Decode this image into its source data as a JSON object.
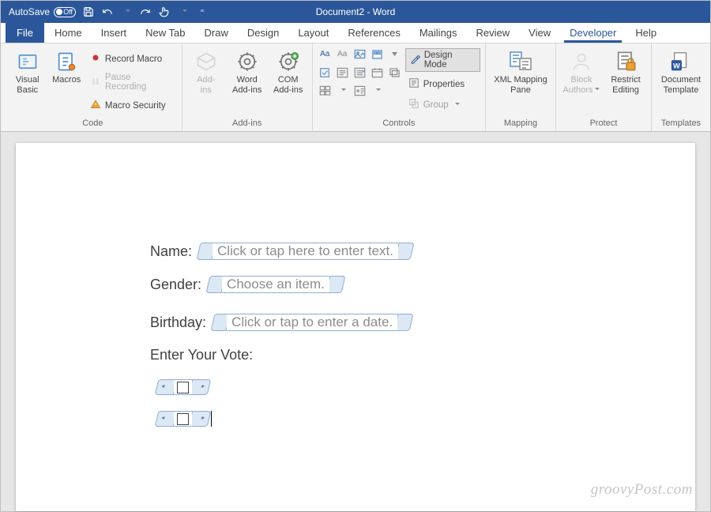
{
  "titlebar": {
    "autosave_label": "AutoSave",
    "autosave_state": "Off",
    "doc_title": "Document2 - Word"
  },
  "tabs": {
    "file": "File",
    "items": [
      "Home",
      "Insert",
      "New Tab",
      "Draw",
      "Design",
      "Layout",
      "References",
      "Mailings",
      "Review",
      "View",
      "Developer",
      "Help"
    ],
    "active": "Developer"
  },
  "ribbon": {
    "code": {
      "visual_basic": "Visual\nBasic",
      "macros": "Macros",
      "record_macro": "Record Macro",
      "pause_recording": "Pause Recording",
      "macro_security": "Macro Security",
      "group_label": "Code"
    },
    "addins": {
      "addins": "Add-\nins",
      "word_addins": "Word\nAdd-ins",
      "com_addins": "COM\nAdd-ins",
      "group_label": "Add-ins"
    },
    "controls": {
      "design_mode": "Design Mode",
      "properties": "Properties",
      "group": "Group",
      "group_label": "Controls"
    },
    "mapping": {
      "xml_mapping_pane": "XML Mapping\nPane",
      "group_label": "Mapping"
    },
    "protect": {
      "block_authors": "Block\nAuthors",
      "restrict_editing": "Restrict\nEditing",
      "group_label": "Protect"
    },
    "templates": {
      "doc_template": "Document\nTemplate",
      "group_label": "Templates"
    }
  },
  "document": {
    "name_label": "Name:",
    "name_placeholder": "Click or tap here to enter text.",
    "gender_label": "Gender:",
    "gender_placeholder": "Choose an item.",
    "birthday_label": "Birthday:",
    "birthday_placeholder": "Click or tap to enter a date.",
    "vote_label": "Enter Your Vote:"
  },
  "watermark": "groovyPost.com"
}
